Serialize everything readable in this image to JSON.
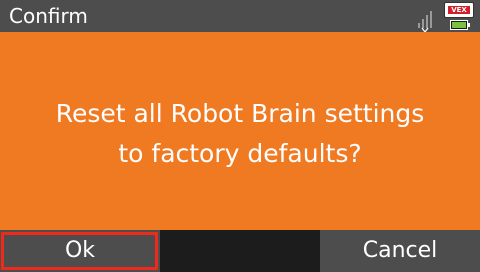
{
  "titlebar": {
    "title": "Confirm",
    "icons": [
      "signal-strength-icon",
      "brand-logo-icon",
      "battery-icon"
    ],
    "brand_logo_text": "VEX",
    "battery_color": "#7ac142",
    "brand_color": "#d0202c"
  },
  "dialog": {
    "message_line1": "Reset all Robot Brain settings",
    "message_line2": "to factory defaults?",
    "background_color": "#f07a22"
  },
  "buttons": {
    "ok_label": "Ok",
    "cancel_label": "Cancel",
    "selected": "Ok",
    "highlight_color": "#ee2a1b"
  }
}
